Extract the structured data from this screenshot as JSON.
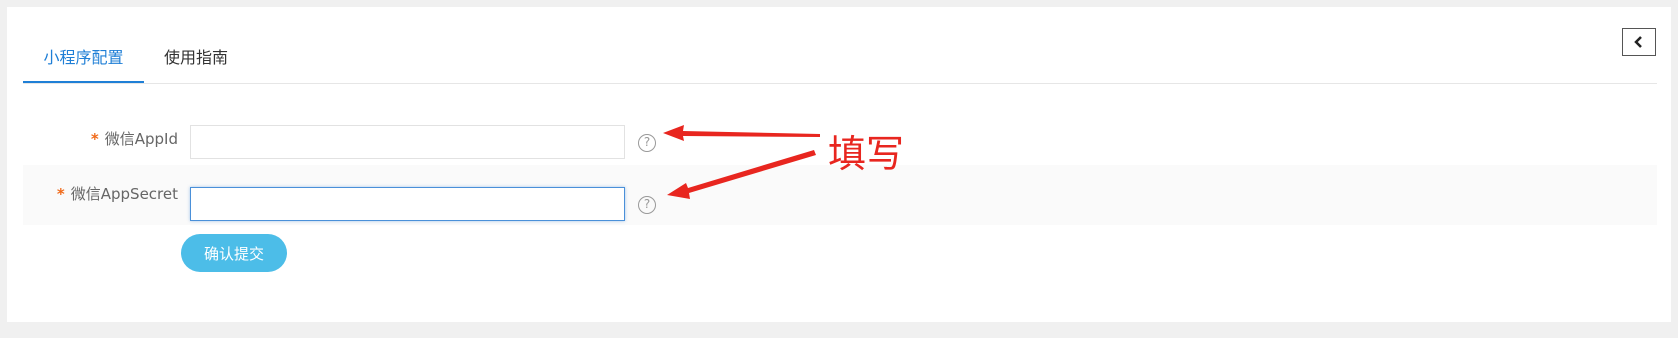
{
  "tabs": [
    {
      "label": "小程序配置",
      "active": true
    },
    {
      "label": "使用指南",
      "active": false
    }
  ],
  "form": {
    "required_mark": "*",
    "appid": {
      "label": "微信AppId",
      "value": "",
      "help": "?"
    },
    "appsecret": {
      "label": "微信AppSecret",
      "value": "",
      "help": "?"
    },
    "submit_label": "确认提交"
  },
  "annotation": {
    "text": "填写",
    "color": "#e8261f"
  },
  "colors": {
    "accent": "#1f7fd6",
    "button": "#4cbde8",
    "required": "#f06a1a"
  }
}
